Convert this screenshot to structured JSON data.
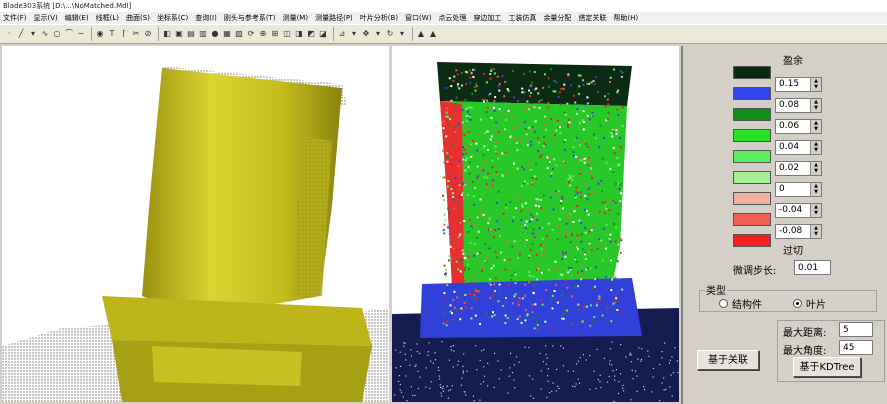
{
  "window": {
    "title": "Blade303系统 [D:\\...\\NoMatched.Mdl]"
  },
  "menu": [
    "文件(F)",
    "显示(V)",
    "编辑(E)",
    "线框(L)",
    "曲面(S)",
    "坐标系(C)",
    "查询(I)",
    "刚头与参考系(T)",
    "测量(M)",
    "测量路径(P)",
    "叶片分析(B)",
    "窗口(W)",
    "点云处理",
    "穿边加工",
    "工装仿真",
    "余量分配",
    "搭定关联",
    "帮助(H)"
  ],
  "legend": {
    "title": "盈余",
    "bottom_label": "过切",
    "colors": [
      "#0a2a12",
      "#3344ee",
      "#109018",
      "#28e028",
      "#5cf05c",
      "#a8f098",
      "#f4b0a0",
      "#f06050",
      "#ee2020"
    ],
    "values": [
      "0.15",
      "0.08",
      "0.06",
      "0.04",
      "0.02",
      "0",
      "-0.04",
      "-0.08"
    ]
  },
  "step": {
    "label": "微调步长:",
    "value": "0.01"
  },
  "type_group": {
    "label": "类型",
    "options": [
      "结构件",
      "叶片"
    ],
    "selected": "叶片"
  },
  "max_distance": {
    "label": "最大距离:",
    "value": "5"
  },
  "max_angle": {
    "label": "最大角度:",
    "value": "45"
  },
  "buttons": {
    "associate": "基于关联",
    "kdtree": "基于KDTree"
  },
  "colors": {
    "blade_yellow": "#c8c020",
    "base_navy": "#141c50"
  }
}
